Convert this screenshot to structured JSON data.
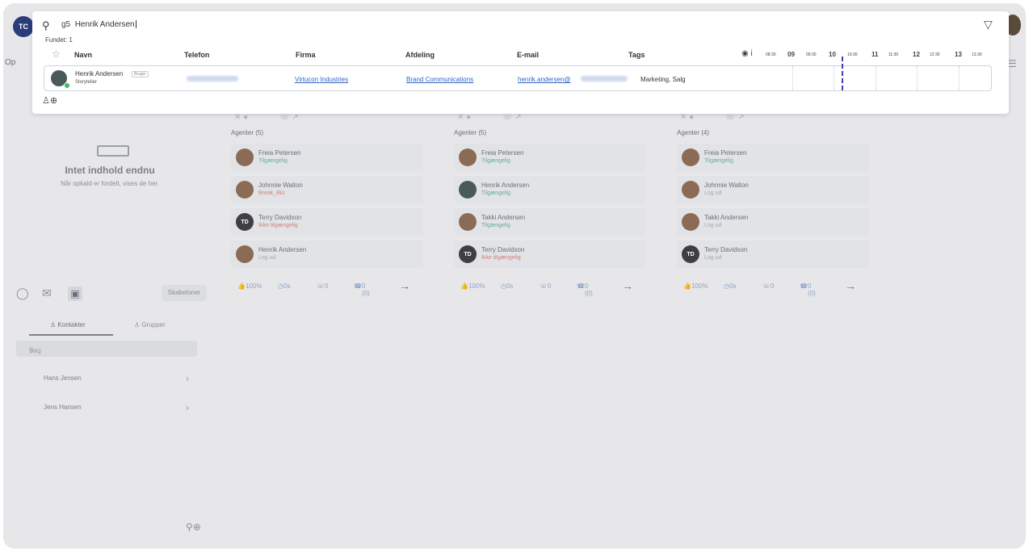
{
  "app": {
    "logo_text": "TC",
    "op_label": "Op"
  },
  "left_panel": {
    "empty_title": "Intet indhold endnu",
    "empty_subtitle": "Når opkald er fordelt, vises de her.",
    "templates_button": "Skabeloner",
    "tabs": [
      "Kontakter",
      "Grupper"
    ],
    "search_placeholder": "Søg",
    "contacts": [
      "Hans Jensen",
      "Jens Hansen"
    ]
  },
  "queues": [
    {
      "agents_label": "Agenter (5)",
      "agents": [
        {
          "name": "Freia Petersen",
          "status": "Tilgængelig",
          "status_type": "green",
          "initials": ""
        },
        {
          "name": "Johnnie Walton",
          "status": "Break_Bio",
          "status_type": "red",
          "initials": ""
        },
        {
          "name": "Terry Davidson",
          "status": "Ikke tilgængelig",
          "status_type": "red",
          "initials": "TD"
        },
        {
          "name": "Henrik Andersen",
          "status": "Log ud",
          "status_type": "gray",
          "initials": ""
        }
      ],
      "stats": {
        "like": "100%",
        "time": "0s",
        "calls": "0",
        "missed": "0 (0)"
      }
    },
    {
      "agents_label": "Agenter (5)",
      "agents": [
        {
          "name": "Freia Petersen",
          "status": "Tilgængelig",
          "status_type": "green",
          "initials": ""
        },
        {
          "name": "Henrik Andersen",
          "status": "Tilgængelig",
          "status_type": "green",
          "initials": ""
        },
        {
          "name": "Takki Andersen",
          "status": "Tilgængelig",
          "status_type": "green",
          "initials": ""
        },
        {
          "name": "Terry Davidson",
          "status": "Ikke tilgængelig",
          "status_type": "red",
          "initials": "TD"
        }
      ],
      "stats": {
        "like": "100%",
        "time": "0s",
        "calls": "0",
        "missed": "0 (0)"
      }
    },
    {
      "agents_label": "Agenter (4)",
      "agents": [
        {
          "name": "Freia Petersen",
          "status": "Tilgængelig",
          "status_type": "green",
          "initials": ""
        },
        {
          "name": "Johnnie Walton",
          "status": "Log ud",
          "status_type": "gray",
          "initials": ""
        },
        {
          "name": "Takki Andersen",
          "status": "Log ud",
          "status_type": "gray",
          "initials": ""
        },
        {
          "name": "Terry Davidson",
          "status": "Log ud",
          "status_type": "gray",
          "initials": "TD"
        }
      ],
      "stats": {
        "like": "100%",
        "time": "0s",
        "calls": "0",
        "missed": "0 (0)"
      }
    }
  ],
  "search_overlay": {
    "query_prefix": "g5",
    "query_text": "Henrik Andersen",
    "found_label": "Fundet: 1",
    "columns": [
      "Navn",
      "Telefon",
      "Firma",
      "Afdeling",
      "E-mail",
      "Tags"
    ],
    "eye_suffix": "i",
    "timeline": [
      "08:30",
      "09",
      "09:30",
      "10",
      "10:30",
      "11",
      "11:30",
      "12",
      "12:30",
      "13",
      "13:30"
    ],
    "result": {
      "name": "Henrik Andersen",
      "badge": "Bruger",
      "role": "Storyteller",
      "company": "Virtucon Industries",
      "department": "Brand Communications",
      "email": "henrik.andersen@",
      "tags": "Marketing, Salg"
    }
  },
  "colors": {
    "accent": "#2f63c4",
    "available": "#3fb96c",
    "now_line": "#3a3fb8"
  }
}
